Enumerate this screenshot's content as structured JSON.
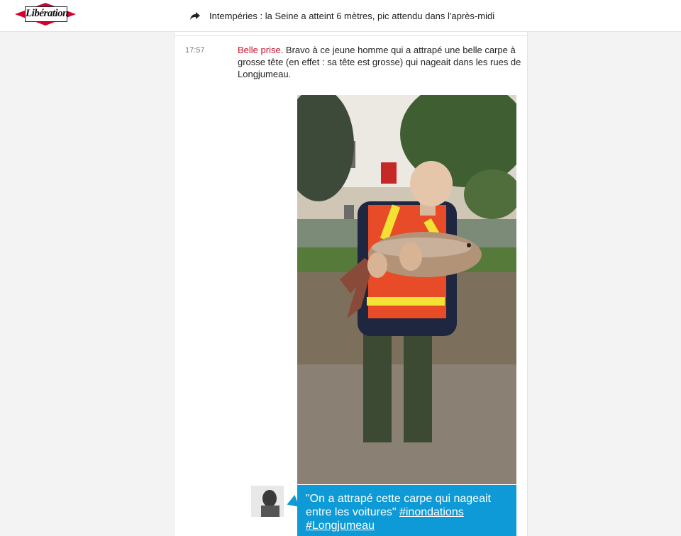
{
  "header": {
    "logo_text": "Libération",
    "headline": "Intempéries : la Seine a atteint 6 mètres, pic attendu dans l'après-midi",
    "share_icon": "share-arrow-icon",
    "logo_red": "#d6002f"
  },
  "post": {
    "time": "17:57",
    "lead": "Belle prise.",
    "body": " Bravo à ce jeune homme qui a attrapé une belle carpe à grosse tête (en effet : sa tête est grosse) qui nageait dans les rues de Longjumeau.",
    "lead_color": "#c8102e"
  },
  "tweet": {
    "text": "\"On a attrapé cette carpe qui nageait entre les voitures\" ",
    "hashtag1": "#inondations",
    "hashtag2": "#Longjumeau",
    "bg_color": "#0e9ad6"
  }
}
